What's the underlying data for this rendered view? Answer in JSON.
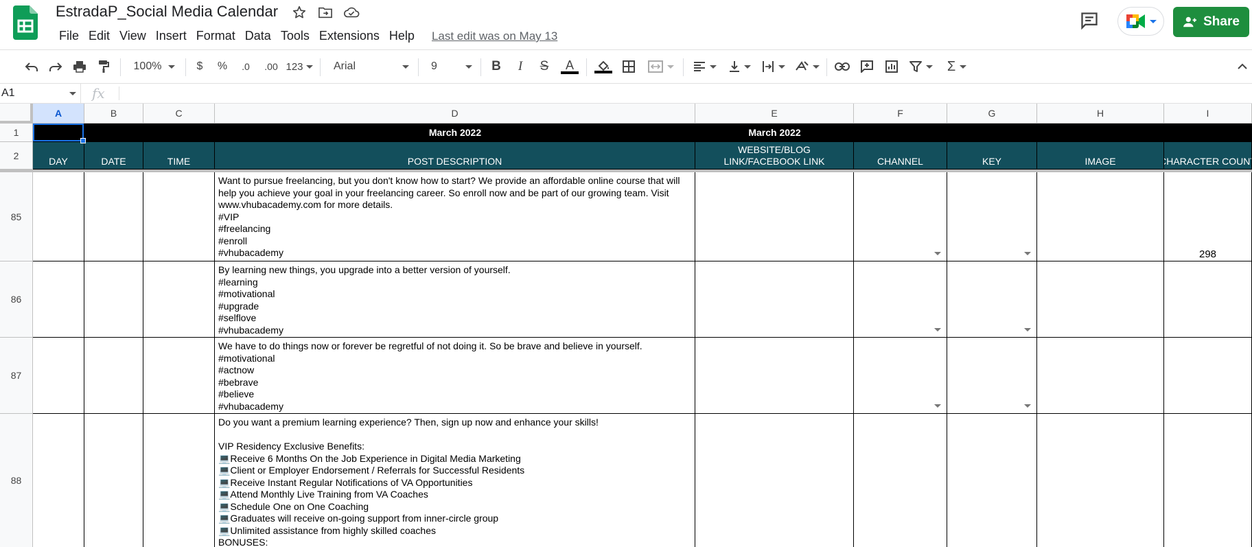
{
  "app": {
    "doc_title": "EstradaP_Social Media Calendar",
    "menus": [
      "File",
      "Edit",
      "View",
      "Insert",
      "Format",
      "Data",
      "Tools",
      "Extensions",
      "Help"
    ],
    "last_edit": "Last edit was on May 13",
    "share_label": "Share",
    "accent_color": "#1e8e3e"
  },
  "toolbar": {
    "zoom": "100%",
    "currency": "$",
    "percent": "%",
    "decrease_decimal": ".0",
    "increase_decimal": ".00",
    "number_format": "123",
    "font": "Arial",
    "font_size": "9"
  },
  "formula_bar": {
    "cell_ref": "A1",
    "fx": "fx",
    "content": ""
  },
  "grid": {
    "columns": [
      "A",
      "B",
      "C",
      "D",
      "E",
      "F",
      "G",
      "H",
      "I"
    ],
    "row1": {
      "row_number": "1",
      "title_d": "March 2022",
      "title_e": "March 2022"
    },
    "row2": {
      "row_number": "2",
      "headers": [
        "DAY",
        "DATE",
        "TIME",
        "POST DESCRIPTION",
        "WEBSITE/BLOG LINK/FACEBOOK LINK",
        "CHANNEL",
        "KEY",
        "IMAGE",
        "CHARACTER COUNT"
      ],
      "header_bg": "#134f5c"
    },
    "rows": [
      {
        "row_number": "85",
        "description": "Want to pursue freelancing, but you don't know how to start? We provide an affordable online course that will help you achieve your goal in your freelancing career. So enroll now and be part of our growing team. Visit www.vhubacademy.com for more details.\n#VIP\n#freelancing\n#enroll\n#vhubacademy",
        "character_count": "298"
      },
      {
        "row_number": "86",
        "description": "By learning new things, you upgrade into a better version of yourself.\n#learning\n#motivational\n#upgrade\n#selflove\n#vhubacademy",
        "character_count": ""
      },
      {
        "row_number": "87",
        "description": "We have to do things now or forever be regretful of not doing it. So be brave and believe in yourself.\n#motivational\n#actnow\n#bebrave\n#believe\n#vhubacademy",
        "character_count": ""
      },
      {
        "row_number": "88",
        "description": "Do you want a premium learning experience? Then, sign up now and enhance your skills!\n\nVIP Residency Exclusive Benefits:\n💻Receive 6 Months On the Job Experience in Digital Media Marketing\n💻Client or Employer Endorsement / Referrals for Successful Residents\n💻Receive Instant Regular Notifications of VA Opportunities\n💻Attend Monthly Live Training from VA Coaches\n💻Schedule One on One Coaching\n💻Graduates will receive on-going support from inner-circle group\n💻Unlimited assistance from highly skilled coaches\nBONUSES:",
        "character_count": ""
      }
    ]
  }
}
